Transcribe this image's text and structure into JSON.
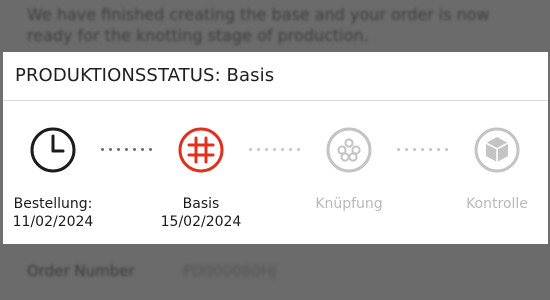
{
  "background": {
    "message_text": "We have finished creating the base and your order is now ready for the knotting stage of production.",
    "order_number_label": "Order Number",
    "order_number_value": "PD000080HJ"
  },
  "modal": {
    "title": "PRODUKTIONSSTATUS: Basis",
    "steps": [
      {
        "icon": "clock-icon",
        "label": "Bestellung:",
        "date": "11/02/2024",
        "state": "done"
      },
      {
        "icon": "grid-knot-icon",
        "label": "Basis",
        "date": "15/02/2024",
        "state": "current"
      },
      {
        "icon": "yarn-balls-icon",
        "label": "Knüpfung",
        "date": "",
        "state": "pending"
      },
      {
        "icon": "box-icon",
        "label": "Kontrolle",
        "date": "",
        "state": "pending"
      }
    ]
  },
  "colors": {
    "current": "#e0301e",
    "done": "#1b1b1b",
    "pending": "#c4c4c4"
  }
}
